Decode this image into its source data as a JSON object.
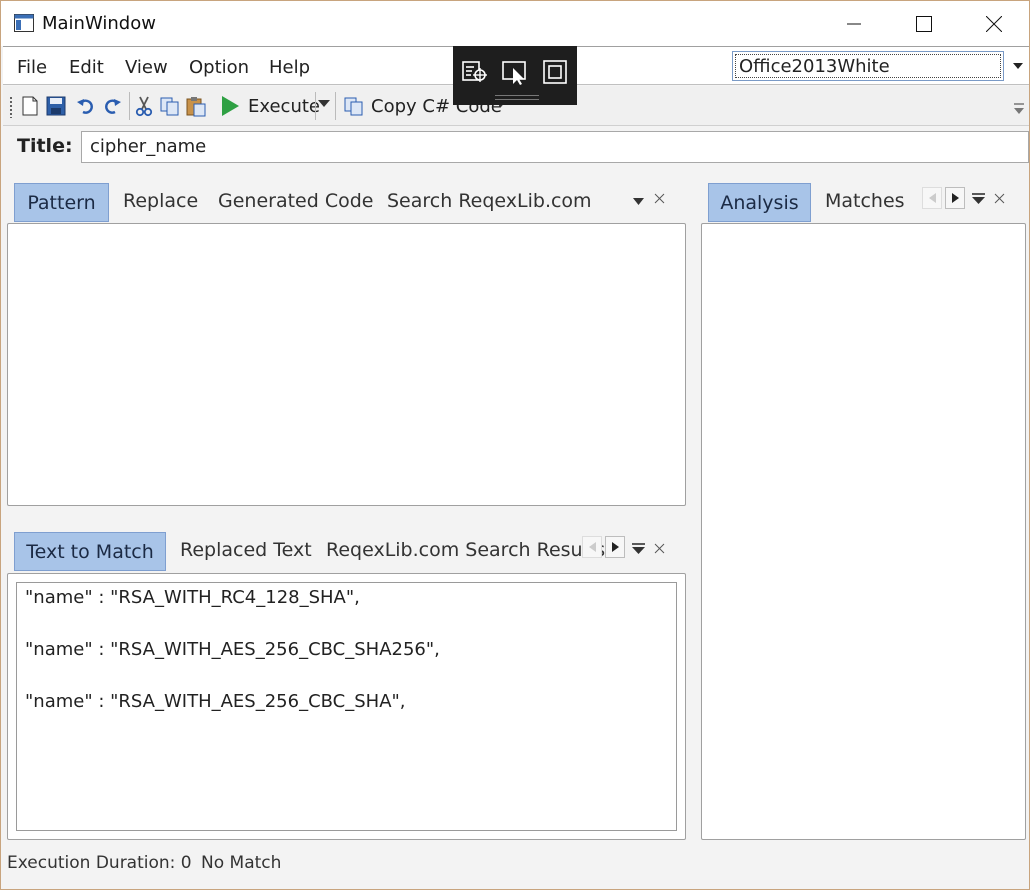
{
  "window": {
    "title": "MainWindow"
  },
  "menu": {
    "items": [
      "File",
      "Edit",
      "View",
      "Option",
      "Help"
    ]
  },
  "theme": {
    "selected": "Office2013White"
  },
  "toolbar": {
    "execute_label": "Execute",
    "copy_code_label": "Copy C# Code",
    "icons": [
      "new-file-icon",
      "save-icon",
      "undo-icon",
      "redo-icon",
      "cut-icon",
      "copy-icon",
      "paste-icon",
      "play-icon"
    ]
  },
  "title_field": {
    "label": "Title:",
    "value": "cipher_name"
  },
  "pattern_tabs": {
    "items": [
      "Pattern",
      "Replace",
      "Generated Code",
      "Search ReqexLib.com"
    ],
    "active": "Pattern"
  },
  "analysis_tabs": {
    "items": [
      "Analysis",
      "Matches"
    ],
    "active": "Analysis"
  },
  "text_tabs": {
    "items": [
      "Text to Match",
      "Replaced Text",
      "ReqexLib.com Search Results"
    ],
    "active": "Text to Match"
  },
  "text_to_match": {
    "lines": [
      "\"name\" : \"RSA_WITH_RC4_128_SHA\",",
      "\"name\" : \"RSA_WITH_AES_256_CBC_SHA256\",",
      "\"name\" : \"RSA_WITH_AES_256_CBC_SHA\","
    ]
  },
  "status": {
    "duration": "Execution Duration: 0",
    "match": "No Match"
  },
  "colors": {
    "active_tab": "#a8c4e8",
    "debug_bar": "#1e1e1e",
    "play_green": "#2ea043"
  }
}
